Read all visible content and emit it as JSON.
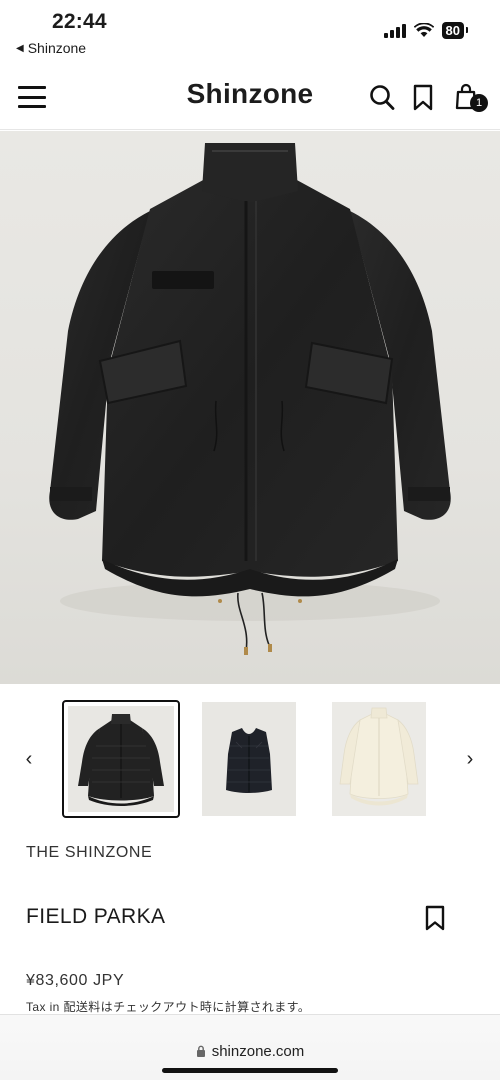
{
  "status_bar": {
    "time": "22:44",
    "back_app": "Shinzone",
    "battery": "80"
  },
  "header": {
    "logo": "Shinzone",
    "cart_count": "1"
  },
  "icons": {
    "menu": "hamburger-menu-icon",
    "search": "search-icon",
    "bookmark": "bookmark-icon",
    "cart": "shopping-bag-icon",
    "prev": "chevron-left-icon",
    "next": "chevron-right-icon",
    "lock": "lock-icon"
  },
  "carousel": {
    "prev_arrow": "‹",
    "next_arrow": "›",
    "selected_index": 0,
    "thumbnails": [
      "black parka",
      "black quilted vest",
      "cream jacket"
    ]
  },
  "product": {
    "vendor": "THE SHINZONE",
    "title": "FIELD PARKA",
    "price": "¥83,600 JPY",
    "tax_note": "Tax in 配送料はチェックアウト時に計算されます。"
  },
  "browser": {
    "url": "shinzone.com"
  },
  "colors": {
    "text": "#1c1c1c",
    "hero_bg": "#e6e5e1",
    "garment_black": "#222222",
    "garment_cream": "#f3eedc"
  }
}
